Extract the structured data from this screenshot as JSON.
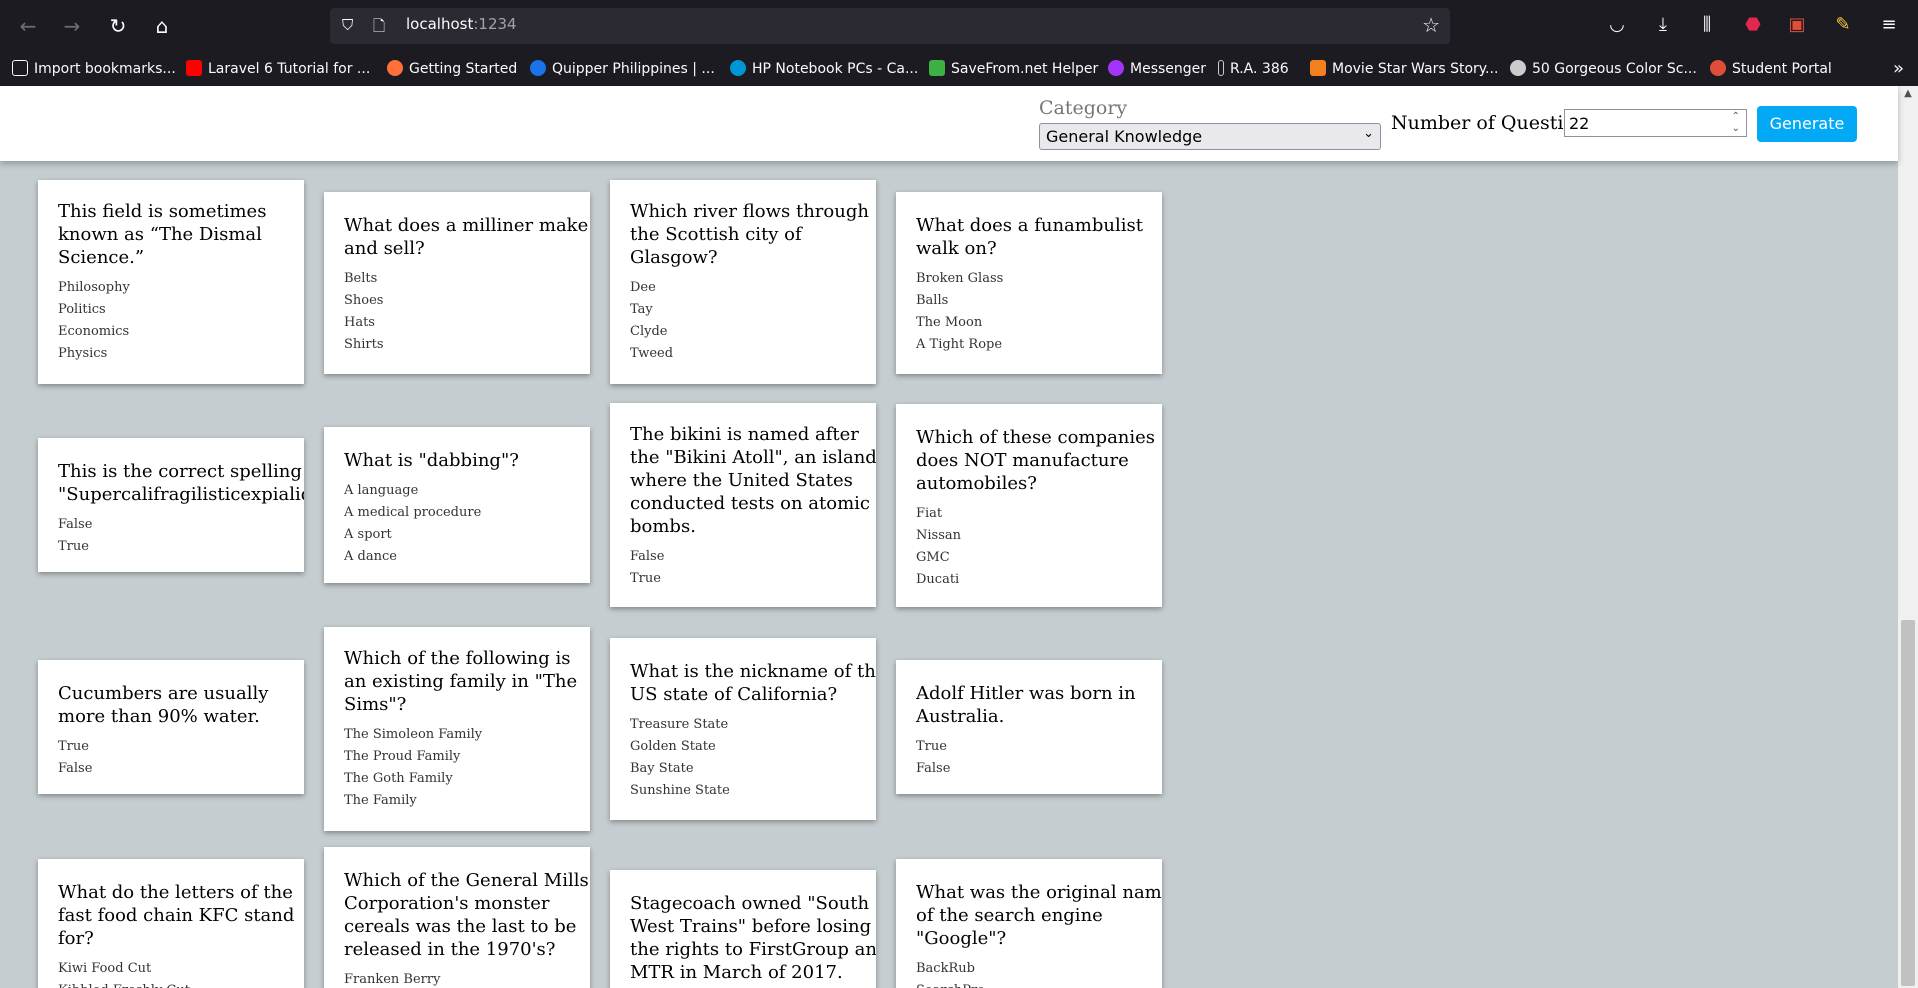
{
  "browser": {
    "url_host": "localhost",
    "url_port": ":1234",
    "bookmarks": [
      {
        "label": "Import bookmarks...",
        "color": "#fbfbfe"
      },
      {
        "label": "Laravel 6 Tutorial for ...",
        "color": "#ff0000"
      },
      {
        "label": "Getting Started",
        "color": "#ff7139"
      },
      {
        "label": "Quipper Philippines | ...",
        "color": "#1a73e8"
      },
      {
        "label": "HP Notebook PCs - Ca...",
        "color": "#0096d6"
      },
      {
        "label": "SaveFrom.net Helper",
        "color": "#3cb043"
      },
      {
        "label": "Messenger",
        "color": "#a334fa"
      },
      {
        "label": "R.A. 386",
        "color": "#cccccc"
      },
      {
        "label": "Movie Star Wars Story...",
        "color": "#f48120"
      },
      {
        "label": "50 Gorgeous Color Sc...",
        "color": "#cccccc"
      },
      {
        "label": "Student Portal",
        "color": "#e04e39"
      }
    ]
  },
  "header": {
    "category_label": "Category",
    "category_value": "General Knowledge",
    "num_questions_label": "Number of Questions",
    "num_questions_value": "22",
    "generate_label": "Generate"
  },
  "cards": [
    {
      "question": [
        "This field is sometimes",
        "known as “The Dismal",
        "Science.”"
      ],
      "answers": [
        "Philosophy",
        "Politics",
        "Economics",
        "Physics"
      ]
    },
    {
      "question": [
        "What does a milliner make",
        "and sell?"
      ],
      "answers": [
        "Belts",
        "Shoes",
        "Hats",
        "Shirts"
      ]
    },
    {
      "question": [
        "Which river flows through",
        "the Scottish city of",
        "Glasgow?"
      ],
      "answers": [
        "Dee",
        "Tay",
        "Clyde",
        "Tweed"
      ]
    },
    {
      "question": [
        "What does a funambulist",
        "walk on?"
      ],
      "answers": [
        "Broken Glass",
        "Balls",
        "The Moon",
        "A Tight Rope"
      ]
    },
    {
      "question": [
        "This is the correct spelling of",
        "\"Supercalifragilisticexpialidocious\"."
      ],
      "answers": [
        "False",
        "True"
      ]
    },
    {
      "question": [
        "What is \"dabbing\"?"
      ],
      "answers": [
        "A language",
        "A medical procedure",
        "A sport",
        "A dance"
      ]
    },
    {
      "question": [
        "The bikini is named after",
        "the \"Bikini Atoll\", an island",
        "where the United States",
        "conducted tests on atomic",
        "bombs."
      ],
      "answers": [
        "False",
        "True"
      ]
    },
    {
      "question": [
        "Which of these companies",
        "does NOT manufacture",
        "automobiles?"
      ],
      "answers": [
        "Fiat",
        "Nissan",
        "GMC",
        "Ducati"
      ]
    },
    {
      "question": [
        "Cucumbers are usually",
        "more than 90% water."
      ],
      "answers": [
        "True",
        "False"
      ]
    },
    {
      "question": [
        "Which of the following is",
        "an existing family in \"The",
        "Sims\"?"
      ],
      "answers": [
        "The Simoleon Family",
        "The Proud Family",
        "The Goth Family",
        "The Family"
      ]
    },
    {
      "question": [
        "What is the nickname of the",
        "US state of California?"
      ],
      "answers": [
        "Treasure State",
        "Golden State",
        "Bay State",
        "Sunshine State"
      ]
    },
    {
      "question": [
        "Adolf Hitler was born in",
        "Australia."
      ],
      "answers": [
        "True",
        "False"
      ]
    },
    {
      "question": [
        "What do the letters of the",
        "fast food chain KFC stand",
        "for?"
      ],
      "answers": [
        "Kiwi Food Cut",
        "Kibbled Freshly Cut"
      ]
    },
    {
      "question": [
        "Which of the General Mills",
        "Corporation's monster",
        "cereals was the last to be",
        "released in the 1970's?"
      ],
      "answers": [
        "Franken Berry"
      ]
    },
    {
      "question": [
        "Stagecoach owned \"South",
        "West Trains\" before losing",
        "the rights to FirstGroup and",
        "MTR in March of 2017."
      ],
      "answers": []
    },
    {
      "question": [
        "What was the original name",
        "of the search engine",
        "\"Google\"?"
      ],
      "answers": [
        "BackRub",
        "SearchPro"
      ]
    }
  ]
}
